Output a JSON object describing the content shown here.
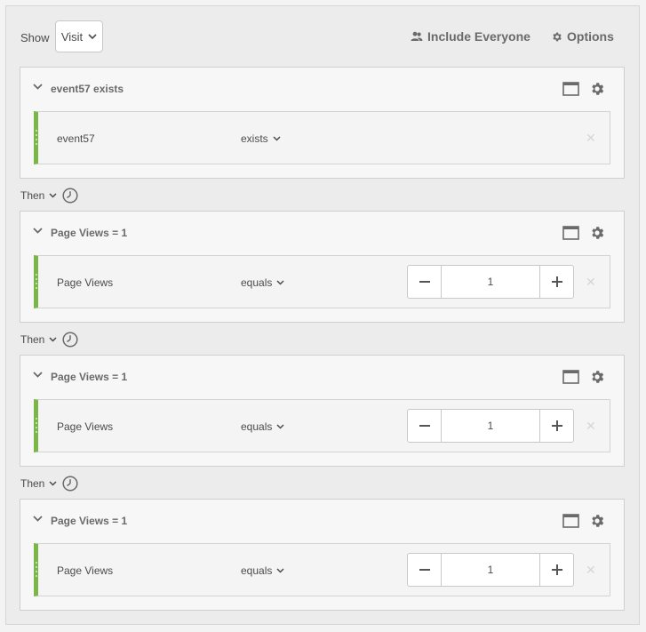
{
  "toolbar": {
    "show_label": "Show",
    "show_value": "Visit",
    "include_everyone": "Include Everyone",
    "options": "Options"
  },
  "containers": [
    {
      "title": "event57 exists",
      "rule": {
        "name": "event57",
        "operator": "exists",
        "value": null
      }
    },
    {
      "title": "Page Views = 1",
      "rule": {
        "name": "Page Views",
        "operator": "equals",
        "value": "1"
      }
    },
    {
      "title": "Page Views = 1",
      "rule": {
        "name": "Page Views",
        "operator": "equals",
        "value": "1"
      }
    },
    {
      "title": "Page Views = 1",
      "rule": {
        "name": "Page Views",
        "operator": "equals",
        "value": "1"
      }
    }
  ],
  "then_label": "Then",
  "icons": {
    "group": "people-icon",
    "options": "gear-icon",
    "window": "window-icon",
    "clock": "clock-icon",
    "remove": "close-icon"
  },
  "colors": {
    "accent": "#7ab648"
  }
}
